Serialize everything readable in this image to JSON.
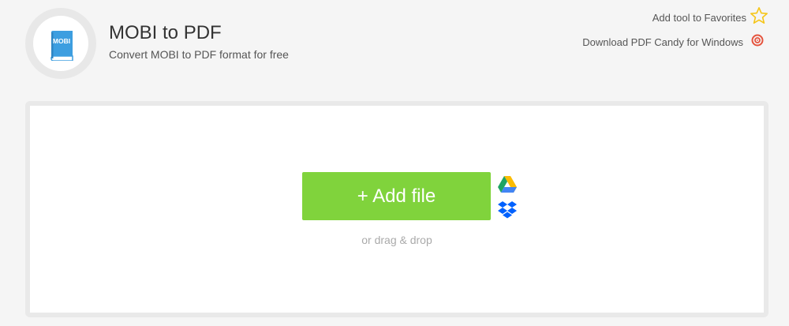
{
  "header": {
    "logo_label": "MOBI",
    "title": "MOBI to PDF",
    "subtitle": "Convert MOBI to PDF format for free"
  },
  "top_links": {
    "favorites": "Add tool to Favorites",
    "download": "Download PDF Candy for Windows"
  },
  "upload": {
    "add_file_label": "+ Add file",
    "drag_drop_label": "or drag & drop",
    "cloud_sources": [
      "google-drive",
      "dropbox"
    ]
  },
  "colors": {
    "accent_green": "#80d33c",
    "book_blue": "#3d9ee0",
    "star_yellow": "#f5c518",
    "candy_red": "#e5533d"
  }
}
